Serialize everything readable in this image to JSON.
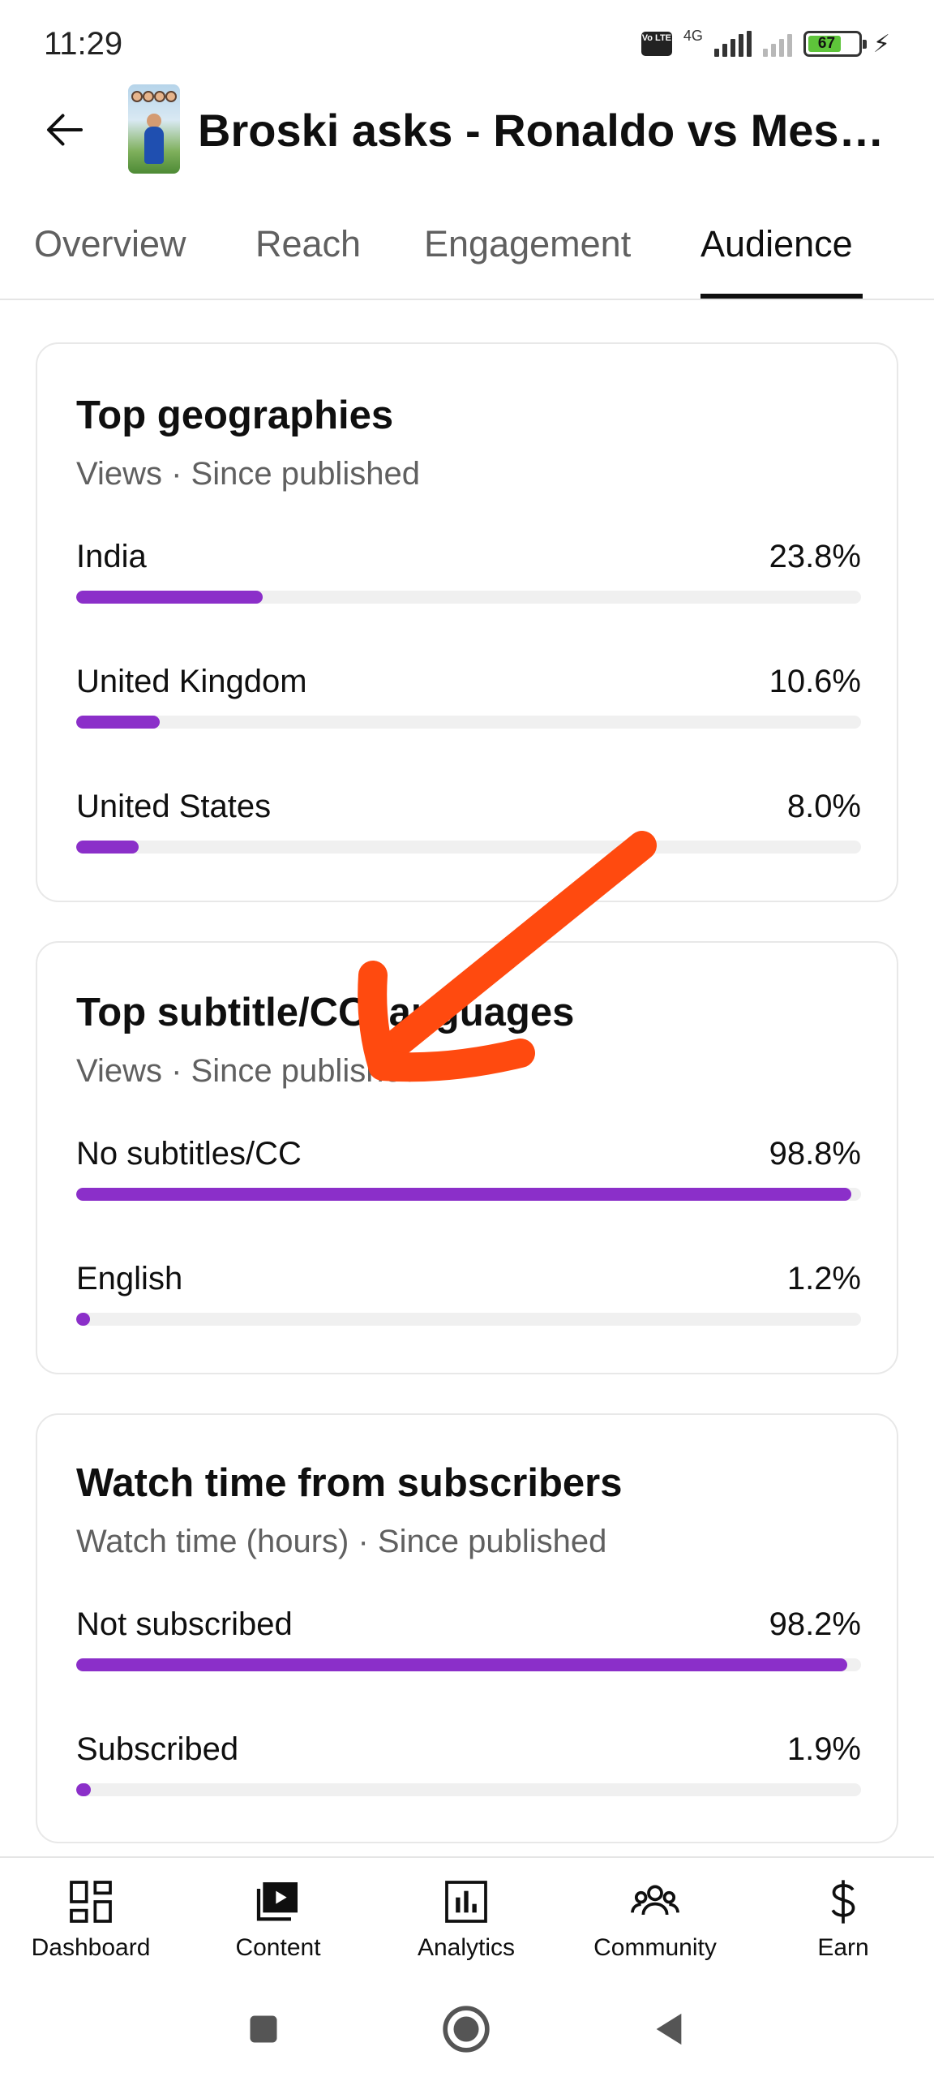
{
  "status_bar": {
    "time": "11:29",
    "network": "4G",
    "volte": "Vo LTE",
    "battery": "67"
  },
  "header": {
    "title": "Broski asks - Ronaldo vs Mess…"
  },
  "tabs": [
    {
      "label": "Overview",
      "active": false
    },
    {
      "label": "Reach",
      "active": false
    },
    {
      "label": "Engagement",
      "active": false
    },
    {
      "label": "Audience",
      "active": true
    }
  ],
  "cards": [
    {
      "title": "Top geographies",
      "subtitle": "Views · Since published",
      "rows": [
        {
          "label": "India",
          "value": "23.8%",
          "fraction": 0.238
        },
        {
          "label": "United Kingdom",
          "value": "10.6%",
          "fraction": 0.106
        },
        {
          "label": "United States",
          "value": "8.0%",
          "fraction": 0.08
        }
      ]
    },
    {
      "title": "Top subtitle/CC languages",
      "subtitle": "Views · Since published",
      "rows": [
        {
          "label": "No subtitles/CC",
          "value": "98.8%",
          "fraction": 0.988
        },
        {
          "label": "English",
          "value": "1.2%",
          "fraction": 0.012
        }
      ]
    },
    {
      "title": "Watch time from subscribers",
      "subtitle": "Watch time (hours) · Since published",
      "rows": [
        {
          "label": "Not subscribed",
          "value": "98.2%",
          "fraction": 0.982
        },
        {
          "label": "Subscribed",
          "value": "1.9%",
          "fraction": 0.019
        }
      ]
    }
  ],
  "bottom_nav": [
    {
      "label": "Dashboard",
      "icon": "dashboard-icon"
    },
    {
      "label": "Content",
      "icon": "content-icon"
    },
    {
      "label": "Analytics",
      "icon": "analytics-icon"
    },
    {
      "label": "Community",
      "icon": "community-icon"
    },
    {
      "label": "Earn",
      "icon": "earn-icon"
    }
  ],
  "colors": {
    "bar_accent": "#8b2fc9",
    "bar_track": "#f0f0f0",
    "annotation_arrow": "#ff4a0f"
  }
}
